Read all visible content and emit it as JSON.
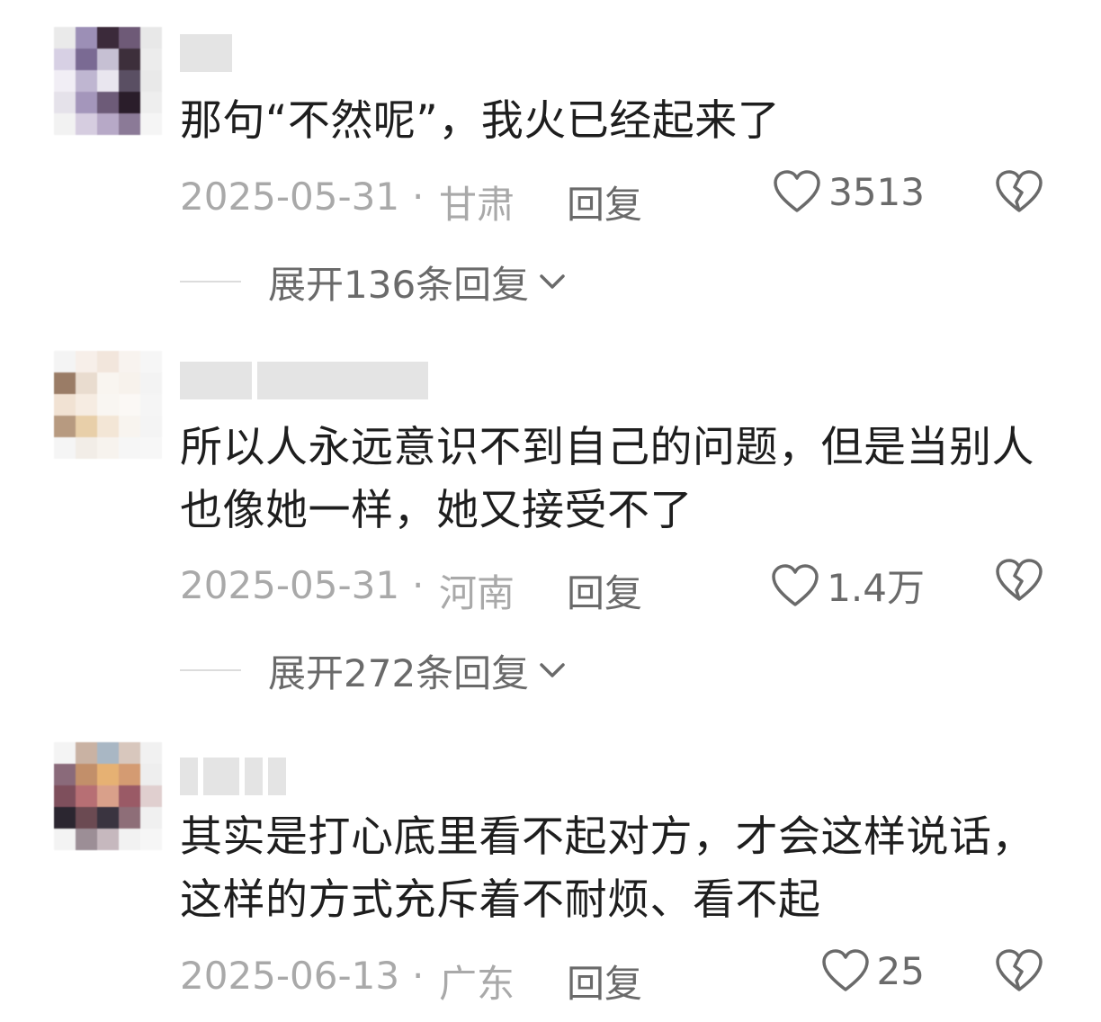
{
  "comments": [
    {
      "text": "那句“不然呢”，我火已经起来了",
      "date": "2025-05-31",
      "separator": "·",
      "location": "甘肃",
      "reply_label": "回复",
      "likes": "3513",
      "expand_label": "展开136条回复",
      "avatar_colors": [
        "#eaeaea",
        "#9c8fb6",
        "#3b2a3a",
        "#6e5a77",
        "#e8e8e8",
        "#d7d0e4",
        "#7a6a93",
        "#c6c0d3",
        "#3d2f3b",
        "#ececec",
        "#f1eef5",
        "#bfb6d1",
        "#e9e6ef",
        "#5a4f63",
        "#e9e9e9",
        "#e5e2ea",
        "#a496bb",
        "#6d5b78",
        "#2a1d2a",
        "#eeeeee",
        "#f2f2f2",
        "#d6cde0",
        "#b7a9c7",
        "#8b7a97",
        "#f5f5f5"
      ],
      "username_blocks": [
        58
      ]
    },
    {
      "text": "所以人永远意识不到自己的问题，但是当别人也像她一样，她又接受不了",
      "date": "2025-05-31",
      "separator": "·",
      "location": "河南",
      "reply_label": "回复",
      "likes": "1.4万",
      "expand_label": "展开272条回复",
      "avatar_colors": [
        "#f4f4f4",
        "#f7efe9",
        "#f2e6dc",
        "#f8f3ef",
        "#f6f6f6",
        "#9a7c66",
        "#e9dccf",
        "#f9f5f0",
        "#f7f2ec",
        "#f3f3f3",
        "#f1e2d3",
        "#f6ece2",
        "#f9f6f2",
        "#fbf8f5",
        "#f5f5f5",
        "#b79a80",
        "#e8cfa9",
        "#f3e6d6",
        "#f8f4ef",
        "#f4f4f4",
        "#f5f5f5",
        "#f2ede7",
        "#f7f3ee",
        "#f6f6f6",
        "#f7f7f7"
      ],
      "username_blocks": [
        80,
        190
      ]
    },
    {
      "text": "其实是打心底里看不起对方，才会这样说话，这样的方式充斥着不耐烦、看不起",
      "date": "2025-06-13",
      "separator": "·",
      "location": "广东",
      "reply_label": "回复",
      "likes": "25",
      "avatar_colors": [
        "#f4f4f4",
        "#c9b2a3",
        "#a9b7c4",
        "#d8c7bd",
        "#f1f1f1",
        "#8a6a7a",
        "#c28f6a",
        "#e6b173",
        "#d49b72",
        "#eeeeee",
        "#7e4f5c",
        "#b76f74",
        "#d9a08a",
        "#9a5a66",
        "#e0cfcf",
        "#2b2630",
        "#6b4a52",
        "#3a3440",
        "#8e6e78",
        "#f0f0f0",
        "#f3f3f3",
        "#9c8e96",
        "#c6b8be",
        "#f2f2f2",
        "#f6f6f6"
      ],
      "username_blocks": [
        20,
        40,
        20,
        20
      ]
    }
  ],
  "icons": {
    "like": "heart-outline-icon",
    "dislike": "broken-heart-icon",
    "expand": "chevron-down-icon"
  },
  "colors": {
    "text": "#1e1e1e",
    "meta": "#a9a9a9",
    "action": "#6a6a6a"
  }
}
